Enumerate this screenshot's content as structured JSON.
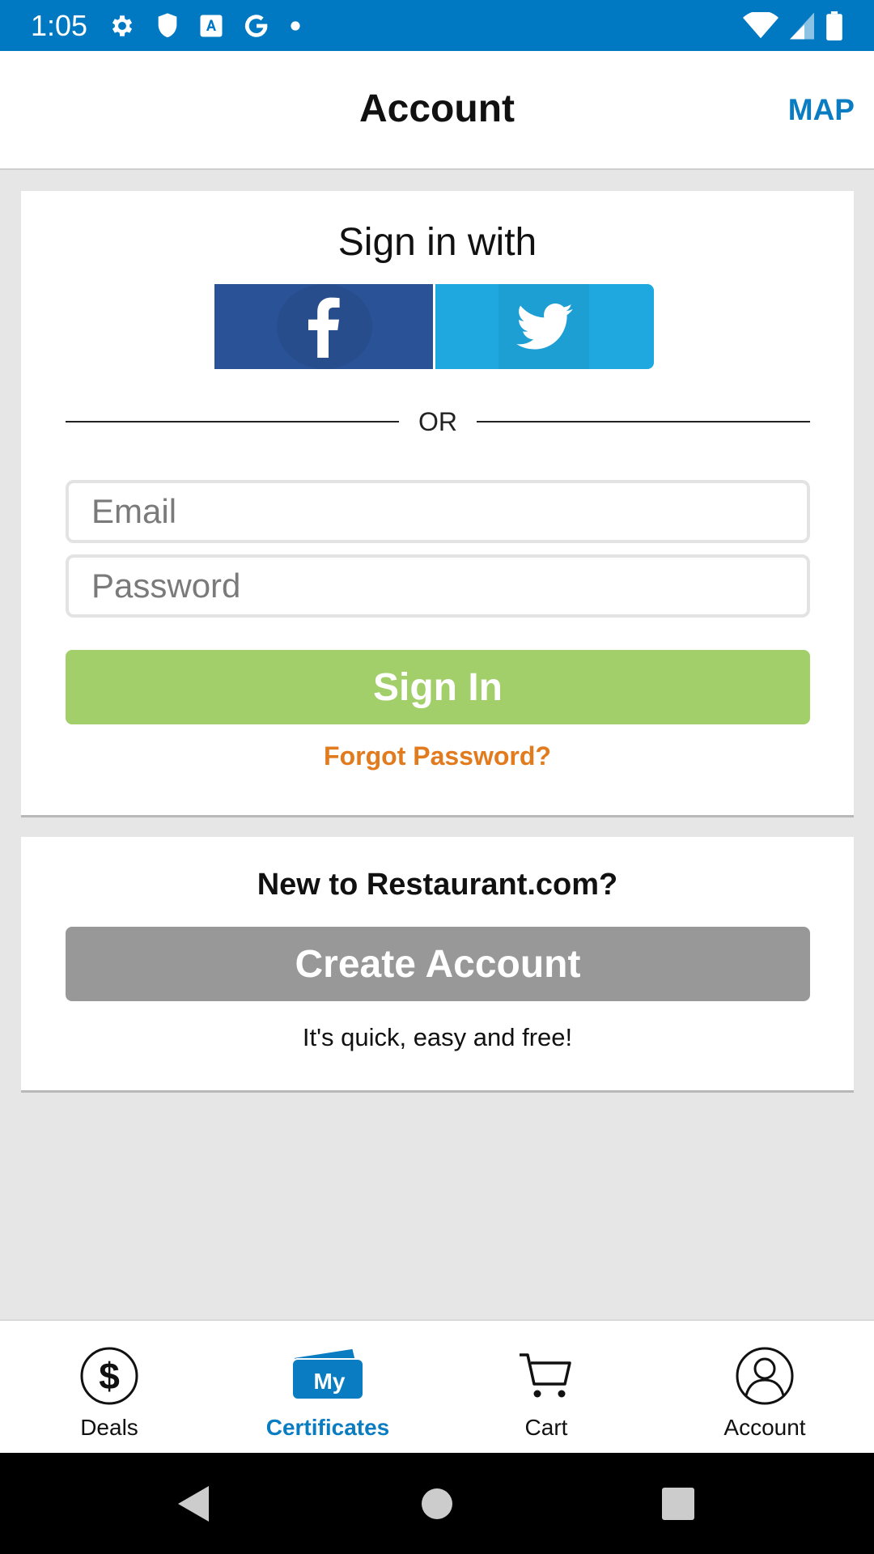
{
  "status_bar": {
    "time": "1:05",
    "left_icons": [
      "gear-icon",
      "shield-icon",
      "translate-icon",
      "google-icon",
      "dot-icon"
    ],
    "right_icons": [
      "wifi-icon",
      "signal-icon",
      "battery-icon"
    ],
    "bg_color": "#0179c2"
  },
  "app_bar": {
    "title": "Account",
    "map_label": "MAP"
  },
  "signin": {
    "title": "Sign in with",
    "facebook_icon": "facebook-icon",
    "twitter_icon": "twitter-icon",
    "or_text": "OR",
    "email_placeholder": "Email",
    "password_placeholder": "Password",
    "signin_label": "Sign In",
    "forgot_label": "Forgot Password?",
    "colors": {
      "facebook": "#2a5296",
      "twitter": "#1fa8e0",
      "signin": "#a2cf6a",
      "forgot": "#e17b1e"
    }
  },
  "new_account": {
    "title": "New to Restaurant.com?",
    "create_label": "Create Account",
    "subtitle": "It's quick, easy and free!"
  },
  "bottom_nav": {
    "items": [
      {
        "label": "Deals",
        "icon": "dollar-icon",
        "active": false
      },
      {
        "label": "Certificates",
        "icon": "my-certificates-icon",
        "active": true
      },
      {
        "label": "Cart",
        "icon": "cart-icon",
        "active": false
      },
      {
        "label": "Account",
        "icon": "user-icon",
        "active": false
      }
    ],
    "active_color": "#0a7cc1"
  },
  "system_nav": {
    "buttons": [
      "back-icon",
      "home-icon",
      "recents-icon"
    ]
  }
}
